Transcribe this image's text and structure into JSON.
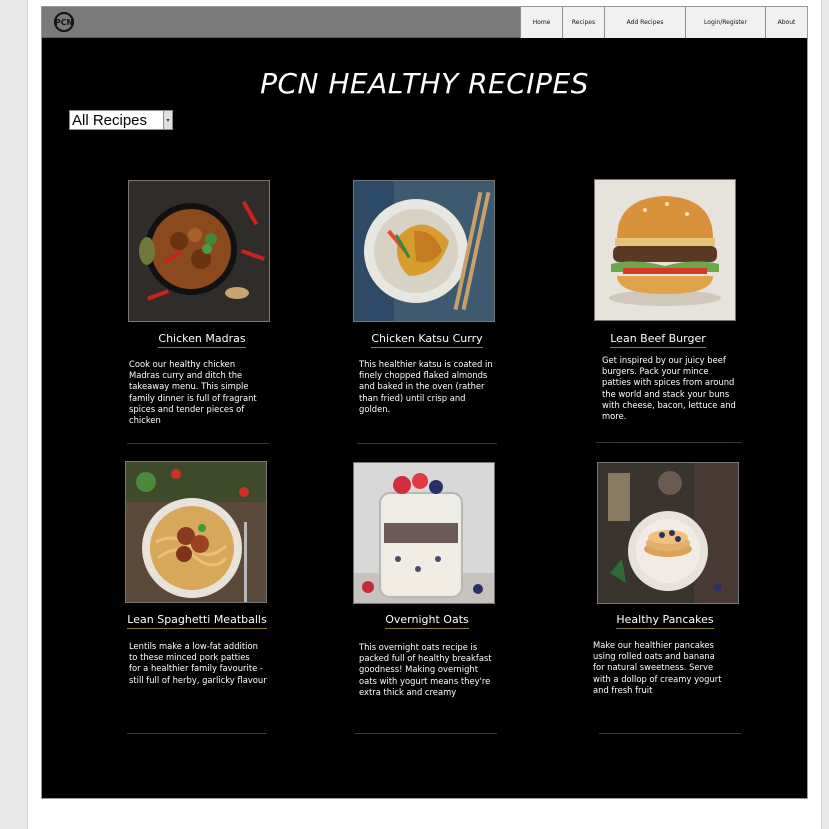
{
  "nav": {
    "logo_text": "PCN",
    "items": [
      "Home",
      "Recipes",
      "Add Recipes",
      "Login/Register",
      "About"
    ]
  },
  "page": {
    "title": "PCN HEALTHY RECIPES",
    "filter_value": "All Recipes"
  },
  "recipes": [
    {
      "title": "Chicken Madras",
      "description": "Cook our healthy chicken\nMadras curry and ditch the\ntakeaway menu. This simple\nfamily dinner is full of fragrant\nspices and tender pieces of\nchicken"
    },
    {
      "title": "Chicken Katsu Curry",
      "description": "This healthier katsu is coated in\nfinely chopped flaked almonds\nand baked in the oven (rather\nthan fried) until crisp and\ngolden."
    },
    {
      "title": "Lean Beef Burger",
      "description": "Get inspired by our juicy beef\nburgers. Pack your mince\npatties with spices from around\nthe world and stack your buns\nwith cheese, bacon, lettuce and\nmore."
    },
    {
      "title": "Lean Spaghetti Meatballs",
      "description": "Lentils make a low-fat addition\nto these minced pork patties\nfor a healthier family favourite -\nstill full of herby, garlicky flavour"
    },
    {
      "title": "Overnight Oats",
      "description": "This overnight oats recipe is\npacked full of healthy breakfast\ngoodness! Making overnight\noats with yogurt means they're\nextra thick and creamy"
    },
    {
      "title": "Healthy Pancakes",
      "description": "Make our healthier pancakes\nusing rolled oats and banana\nfor natural sweetness. Serve\nwith a dollop of creamy yogurt\nand fresh fruit"
    }
  ]
}
